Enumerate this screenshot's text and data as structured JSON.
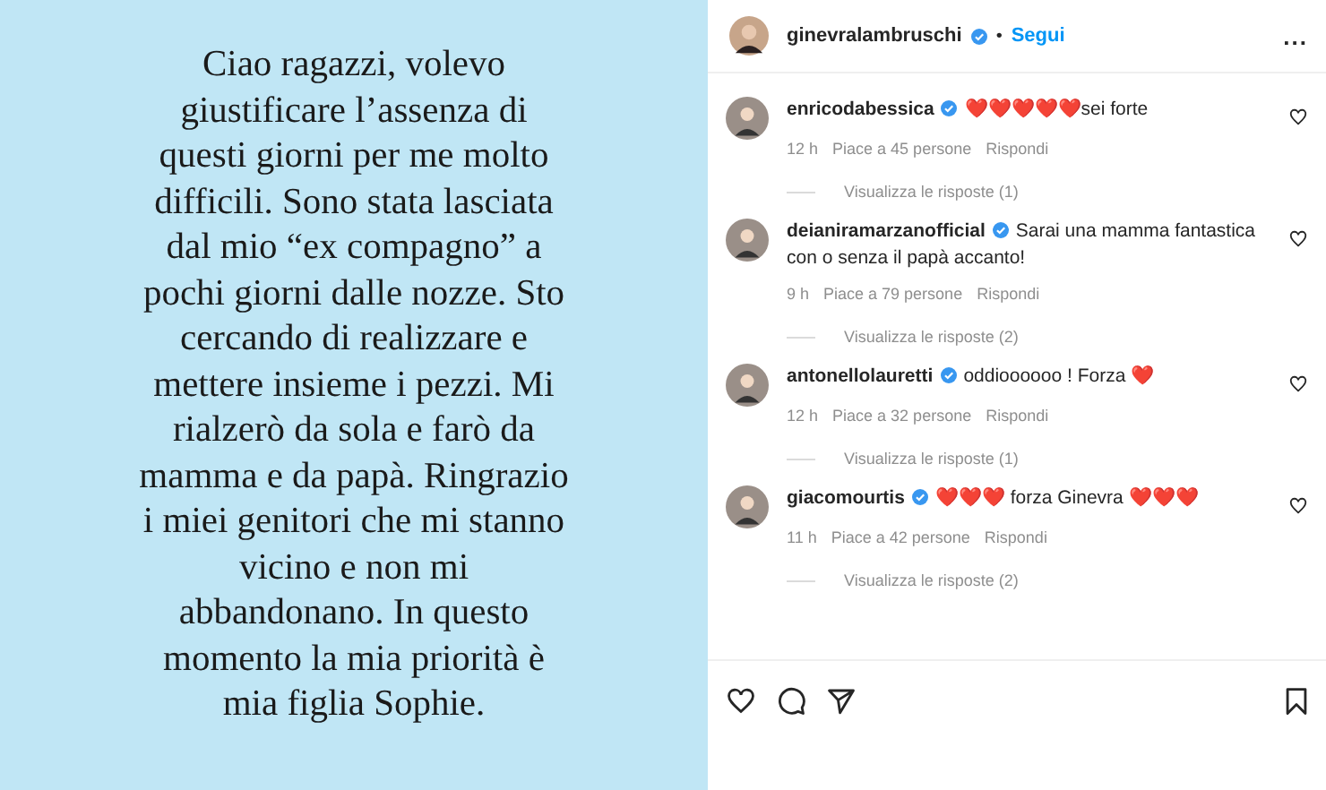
{
  "post_image": {
    "lines": [
      "Ciao ragazzi, volevo",
      "giustificare l’assenza di",
      "questi giorni per me molto",
      "difficili. Sono stata lasciata",
      "dal mio “ex compagno” a",
      "pochi giorni dalle nozze. Sto",
      "cercando di realizzare e",
      "mettere insieme i pezzi. Mi",
      "rialzerò da sola e farò da",
      "mamma e da papà. Ringrazio",
      "i miei genitori che mi stanno",
      "vicino e non mi",
      "abbandonano. In questo",
      "momento la mia priorità è",
      "mia figlia Sophie."
    ]
  },
  "header": {
    "username": "ginevralambruschi",
    "verified": true,
    "separator": "•",
    "follow": "Segui",
    "more": "..."
  },
  "comments": [
    {
      "username": "enricodabessica",
      "verified": true,
      "text": "❤️❤️❤️❤️❤️sei forte",
      "time": "12 h",
      "likes": "Piace a 45 persone",
      "reply": "Rispondi",
      "replies": "Visualizza le risposte (1)"
    },
    {
      "username": "deianiramarzanofficial",
      "verified": true,
      "text": "Sarai una mamma fantastica con o senza il papà accanto!",
      "time": "9 h",
      "likes": "Piace a 79 persone",
      "reply": "Rispondi",
      "replies": "Visualizza le risposte (2)"
    },
    {
      "username": "antonellolauretti",
      "verified": true,
      "text": "oddioooooo ! Forza ❤️",
      "time": "12 h",
      "likes": "Piace a 32 persone",
      "reply": "Rispondi",
      "replies": "Visualizza le risposte (1)"
    },
    {
      "username": "giacomourtis",
      "verified": true,
      "text": "❤️❤️❤️ forza Ginevra ❤️❤️❤️",
      "time": "11 h",
      "likes": "Piace a 42 persone",
      "reply": "Rispondi",
      "replies": "Visualizza le risposte (2)"
    }
  ]
}
